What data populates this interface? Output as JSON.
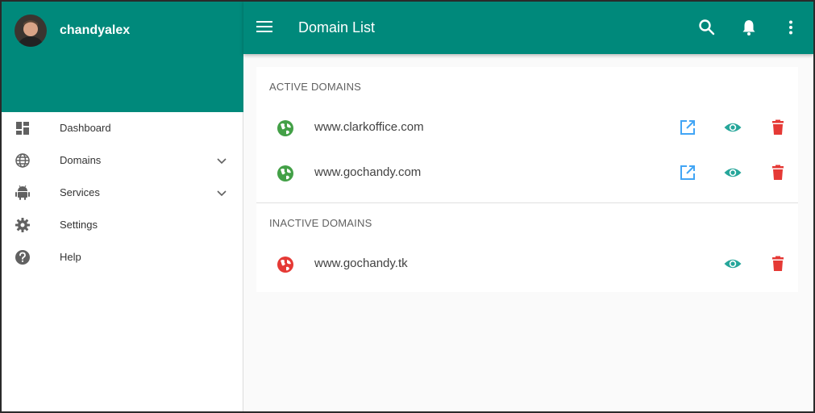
{
  "user": {
    "name": "chandyalex"
  },
  "appbar": {
    "title": "Domain List"
  },
  "sidebar": {
    "items": [
      {
        "label": "Dashboard",
        "icon": "dashboard-icon"
      },
      {
        "label": "Domains",
        "icon": "globe-icon",
        "expandable": true
      },
      {
        "label": "Services",
        "icon": "android-icon",
        "expandable": true
      },
      {
        "label": "Settings",
        "icon": "gear-icon"
      },
      {
        "label": "Help",
        "icon": "help-icon"
      }
    ]
  },
  "sections": {
    "active": {
      "title": "ACTIVE DOMAINS",
      "domains": [
        "www.clarkoffice.com",
        "www.gochandy.com"
      ]
    },
    "inactive": {
      "title": "INACTIVE DOMAINS",
      "domains": [
        "www.gochandy.tk"
      ]
    }
  },
  "colors": {
    "primary": "#00897b",
    "active_globe": "#43a047",
    "inactive_globe": "#e53935",
    "open_link": "#42a5f5",
    "view": "#26a69a",
    "delete": "#e53935"
  }
}
